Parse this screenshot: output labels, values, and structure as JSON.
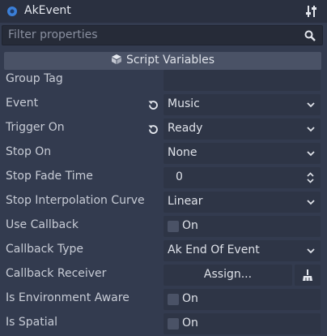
{
  "header": {
    "title": "AkEvent",
    "node_icon": "circle-node-icon",
    "tools_icon": "sliders-icon"
  },
  "filter": {
    "placeholder": "Filter properties",
    "icon": "search-icon"
  },
  "section": {
    "label": "Script Variables",
    "icon": "cube-icon"
  },
  "properties": [
    {
      "label": "Group Tag",
      "value": ""
    },
    {
      "label": "Event",
      "value": "Music",
      "revert": true
    },
    {
      "label": "Trigger On",
      "value": "Ready",
      "revert": true
    },
    {
      "label": "Stop On",
      "value": "None"
    },
    {
      "label": "Stop Fade Time",
      "value": "0"
    },
    {
      "label": "Stop Interpolation Curve",
      "value": "Linear"
    },
    {
      "label": "Use Callback",
      "value": "On",
      "checked": false
    },
    {
      "label": "Callback Type",
      "value": "Ak End Of Event"
    },
    {
      "label": "Callback Receiver",
      "value": "Assign...",
      "clear_icon": "broom-icon"
    },
    {
      "label": "Is Environment Aware",
      "value": "On",
      "checked": false
    },
    {
      "label": "Is Spatial",
      "value": "On",
      "checked": false
    }
  ],
  "colors": {
    "background": "#333b4f",
    "header": "#2a3040",
    "field": "#2e3546",
    "accent": "#3b7fd8"
  }
}
